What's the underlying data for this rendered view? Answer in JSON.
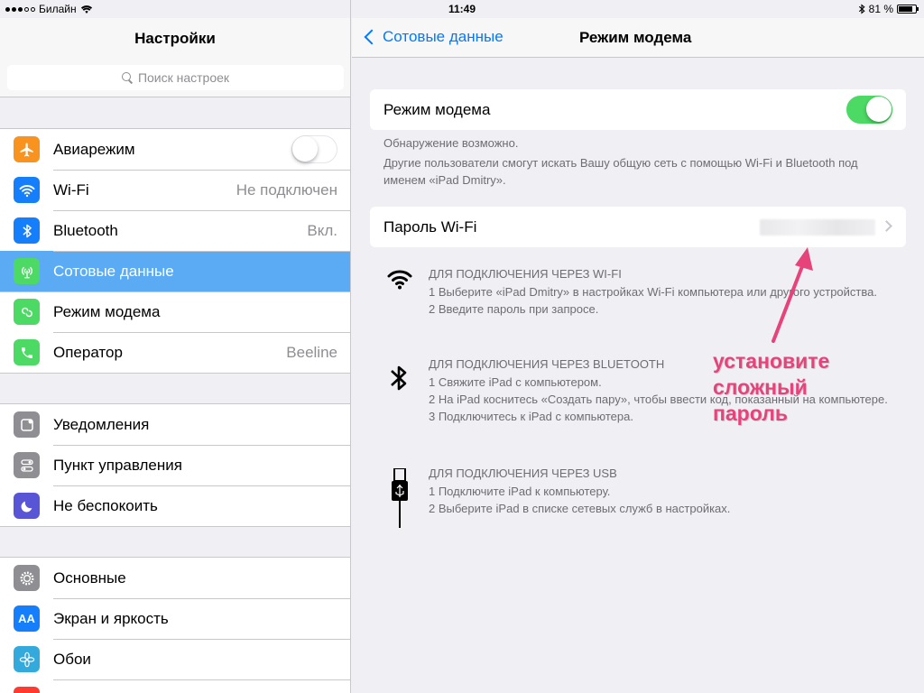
{
  "status_bar": {
    "carrier": "Билайн",
    "time": "11:49",
    "battery_percent": "81 %",
    "battery_level": 0.81,
    "bluetooth_icon": "bluetooth-icon"
  },
  "left": {
    "title": "Настройки",
    "search_placeholder": "Поиск настроек",
    "groups": [
      [
        {
          "label": "Авиарежим",
          "icon": "airplane-icon",
          "color": "#f7931e",
          "toggle": false
        },
        {
          "label": "Wi-Fi",
          "icon": "wifi-icon",
          "color": "#147efb",
          "value": "Не подключен"
        },
        {
          "label": "Bluetooth",
          "icon": "bluetooth-icon",
          "color": "#147efb",
          "value": "Вкл."
        },
        {
          "label": "Сотовые данные",
          "icon": "cellular-icon",
          "color": "#4cd964",
          "selected": true
        },
        {
          "label": "Режим модема",
          "icon": "hotspot-icon",
          "color": "#4cd964"
        },
        {
          "label": "Оператор",
          "icon": "phone-icon",
          "color": "#4cd964",
          "value": "Beeline"
        }
      ],
      [
        {
          "label": "Уведомления",
          "icon": "notifications-icon",
          "color": "#8e8e93"
        },
        {
          "label": "Пункт управления",
          "icon": "control-center-icon",
          "color": "#8e8e93"
        },
        {
          "label": "Не беспокоить",
          "icon": "moon-icon",
          "color": "#5856d6"
        }
      ],
      [
        {
          "label": "Основные",
          "icon": "gear-icon",
          "color": "#8e8e93"
        },
        {
          "label": "Экран и яркость",
          "icon": "display-icon",
          "color": "#147efb",
          "glyph": "AA"
        },
        {
          "label": "Обои",
          "icon": "wallpaper-icon",
          "color": "#34aadc"
        }
      ]
    ]
  },
  "right": {
    "back_label": "Сотовые данные",
    "title": "Режим модема",
    "hotspot_label": "Режим модема",
    "hotspot_on": true,
    "discovery_note": "Обнаружение возможно.",
    "discovery_detail": "Другие пользователи смогут искать Вашу общую сеть с помощью Wi-Fi и Bluetooth под именем «iPad Dmitry».",
    "wifi_password_label": "Пароль Wi-Fi",
    "sections": [
      {
        "icon": "wifi-icon",
        "heading": "ДЛЯ ПОДКЛЮЧЕНИЯ ЧЕРЕЗ WI-FI",
        "steps": [
          "1 Выберите «iPad Dmitry» в настройках Wi-Fi компьютера или другого устройства.",
          "2 Введите пароль при запросе."
        ]
      },
      {
        "icon": "bluetooth-icon",
        "heading": "ДЛЯ ПОДКЛЮЧЕНИЯ ЧЕРЕЗ BLUETOOTH",
        "steps": [
          "1 Свяжите iPad с компьютером.",
          "2 На iPad коснитесь «Создать пару», чтобы ввести код, показанный на компьютере.",
          "3 Подключитесь к iPad с компьютера."
        ]
      },
      {
        "icon": "usb-icon",
        "heading": "ДЛЯ ПОДКЛЮЧЕНИЯ ЧЕРЕЗ USB",
        "steps": [
          "1 Подключите iPad к компьютеру.",
          "2 Выберите iPad в списке сетевых служб в настройках."
        ]
      }
    ],
    "annotation": [
      "установите",
      "сложный",
      "пароль"
    ],
    "annotation_color": "#e6437a"
  }
}
